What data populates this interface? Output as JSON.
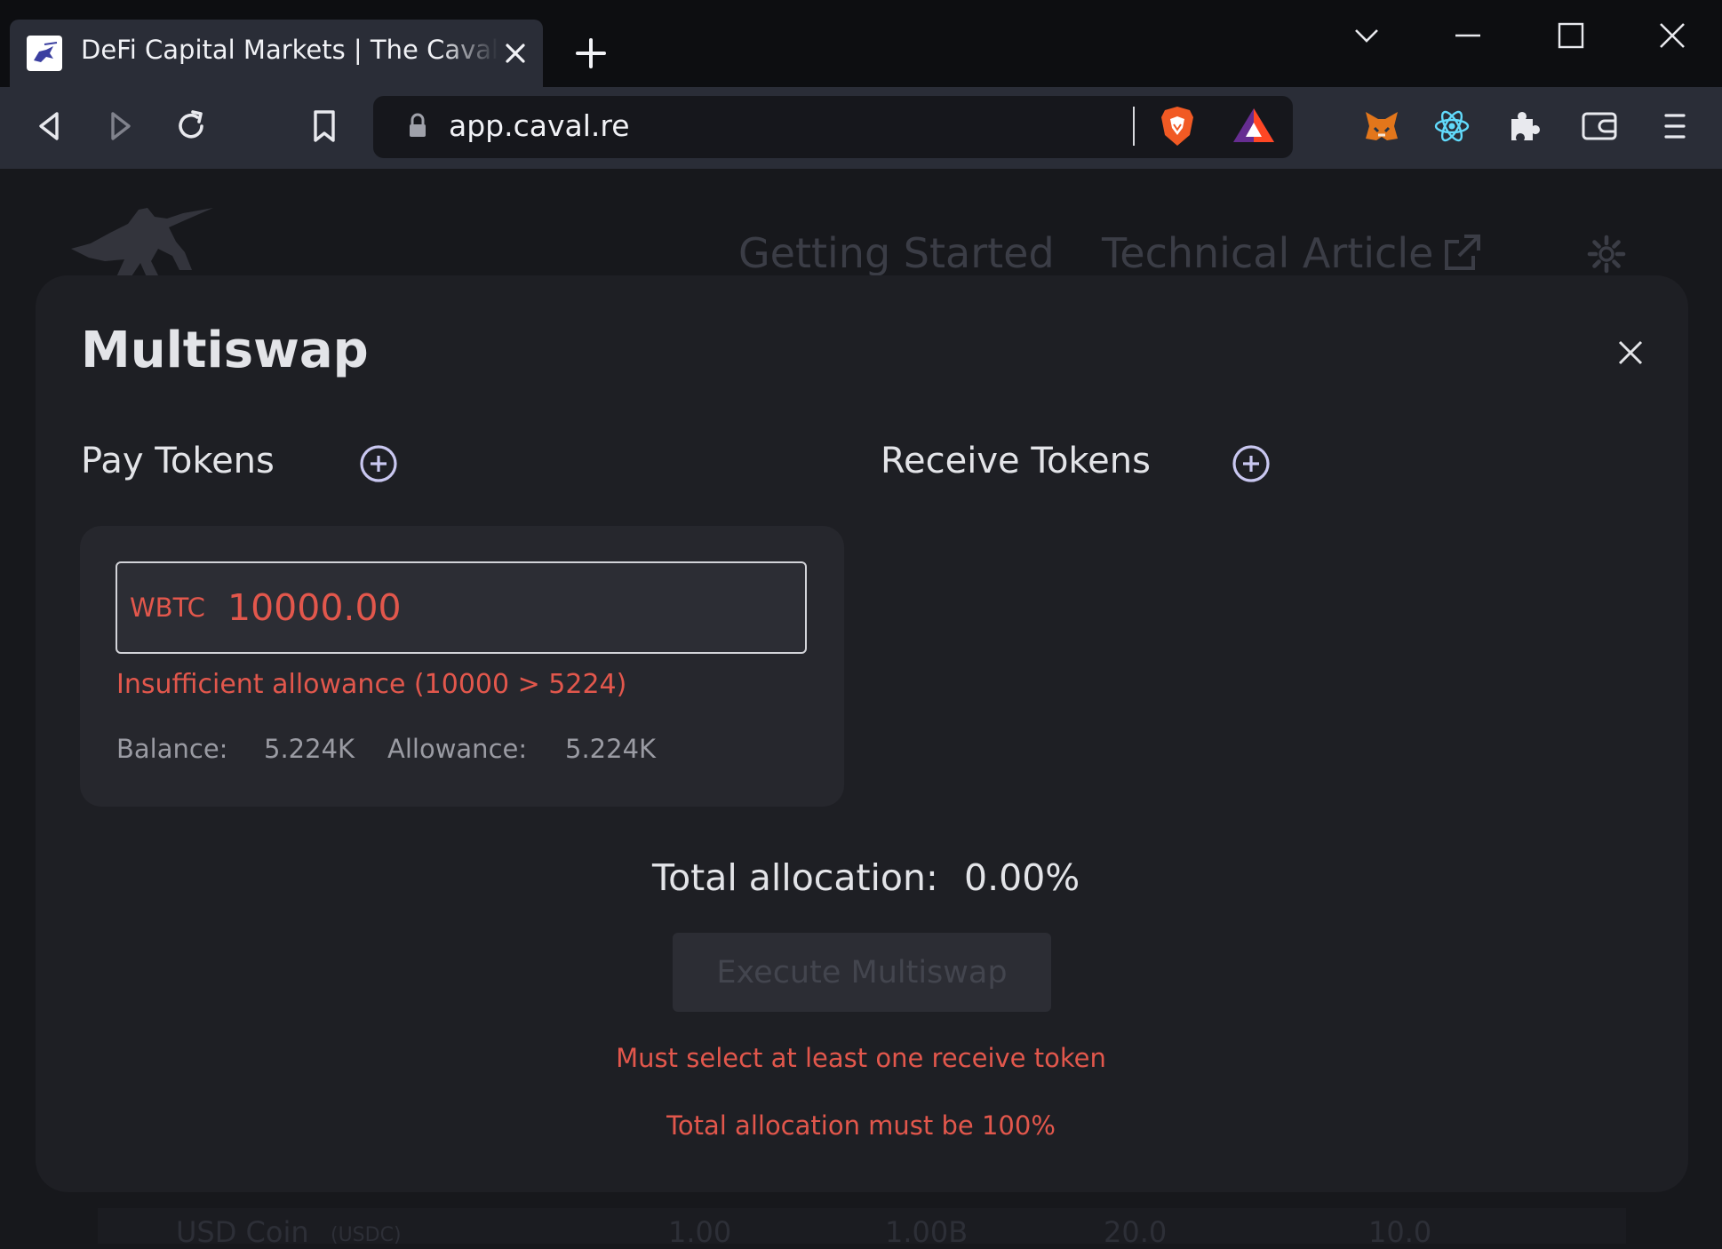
{
  "browser": {
    "tab_title": "DeFi Capital Markets | The CavalRe",
    "url": "app.caval.re"
  },
  "nav": {
    "getting_started": "Getting Started",
    "technical_article": "Technical Article"
  },
  "background_table": {
    "row_name": "USD Coin",
    "row_symbol": "(USDC)",
    "row_values": [
      "1.00",
      "1.00B",
      "20.0",
      "10.0"
    ]
  },
  "modal": {
    "title": "Multiswap",
    "pay_tokens_label": "Pay Tokens",
    "receive_tokens_label": "Receive Tokens",
    "pay_token": {
      "symbol": "WBTC",
      "amount": "10000.00",
      "error": "Insufficient allowance (10000 > 5224)",
      "balance_label": "Balance:",
      "balance_value": "5.224K",
      "allowance_label": "Allowance:",
      "allowance_value": "5.224K"
    },
    "total_allocation_label": "Total allocation:",
    "total_allocation_value": "0.00%",
    "execute_button": "Execute Multiswap",
    "errors": {
      "receive_token": "Must select at least one receive token",
      "allocation": "Total allocation must be 100%"
    }
  },
  "colors": {
    "error": "#e2574c",
    "modal_bg": "#1e1f24",
    "card_bg": "#26272d",
    "accent_icon": "#c9c7f0"
  }
}
